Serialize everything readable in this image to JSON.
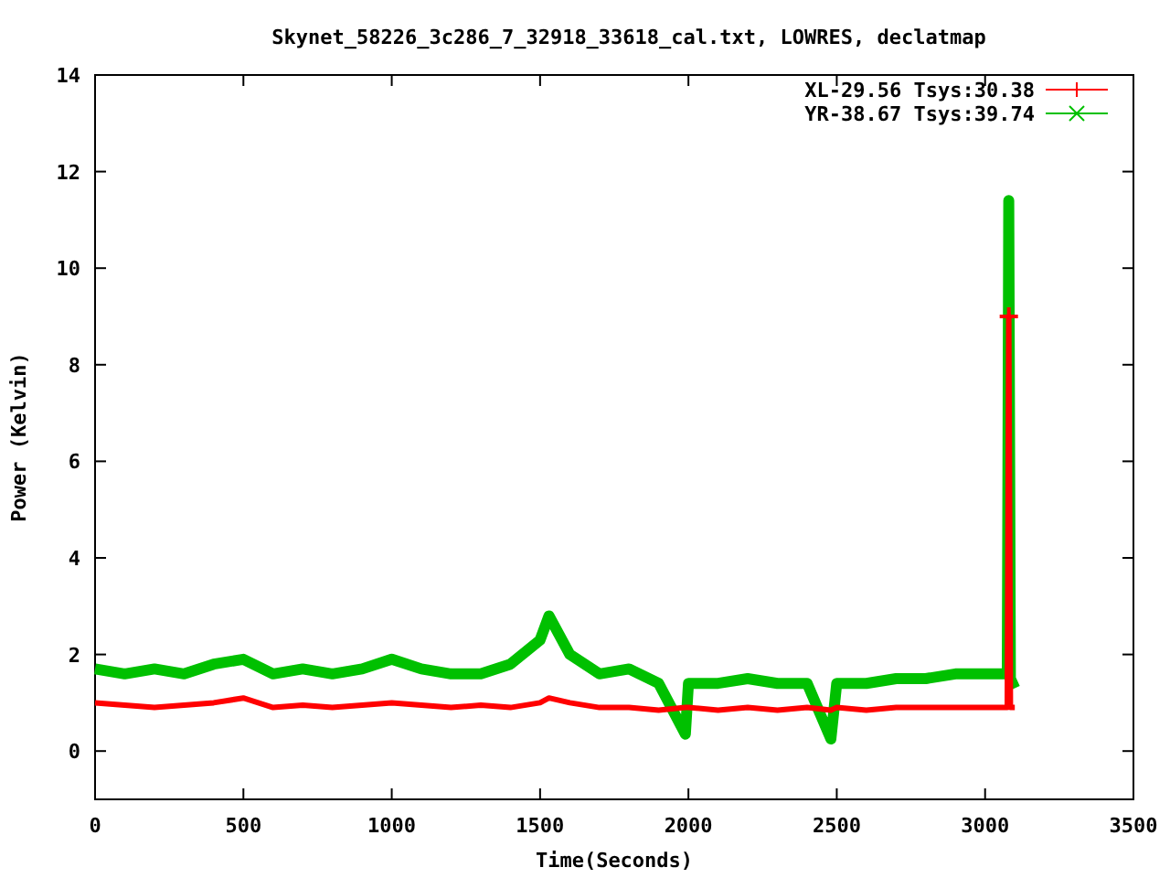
{
  "chart_data": {
    "type": "line",
    "title": "Skynet_58226_3c286_7_32918_33618_cal.txt, LOWRES, declatmap",
    "xlabel": "Time(Seconds)",
    "ylabel": "Power (Kelvin)",
    "x": [
      0,
      100,
      200,
      300,
      400,
      500,
      600,
      700,
      800,
      900,
      1000,
      1100,
      1200,
      1300,
      1400,
      1500,
      1530,
      1600,
      1700,
      1800,
      1900,
      1990,
      2000,
      2100,
      2200,
      2300,
      2400,
      2480,
      2500,
      2600,
      2700,
      2800,
      2900,
      3000,
      3075,
      3080,
      3085,
      3100
    ],
    "series": [
      {
        "name": "XL-29.56 Tsys:30.38",
        "color": "#ff0000",
        "values": [
          1.0,
          0.95,
          0.9,
          0.95,
          1.0,
          1.1,
          0.9,
          0.95,
          0.9,
          0.95,
          1.0,
          0.95,
          0.9,
          0.95,
          0.9,
          1.0,
          1.1,
          1.0,
          0.9,
          0.9,
          0.85,
          0.9,
          0.9,
          0.85,
          0.9,
          0.85,
          0.9,
          0.85,
          0.9,
          0.85,
          0.9,
          0.9,
          0.9,
          0.9,
          0.9,
          9.0,
          0.9,
          0.9
        ]
      },
      {
        "name": "YR-38.67 Tsys:39.74",
        "color": "#00c000",
        "values": [
          1.7,
          1.6,
          1.7,
          1.6,
          1.8,
          1.9,
          1.6,
          1.7,
          1.6,
          1.7,
          1.9,
          1.7,
          1.6,
          1.6,
          1.8,
          2.3,
          2.8,
          2.0,
          1.6,
          1.7,
          1.4,
          0.35,
          1.4,
          1.4,
          1.5,
          1.4,
          1.4,
          0.25,
          1.4,
          1.4,
          1.5,
          1.5,
          1.6,
          1.6,
          1.6,
          11.4,
          1.5,
          1.3
        ]
      }
    ],
    "legend": true,
    "xlim": [
      0,
      3500
    ],
    "ylim": [
      -1,
      14
    ],
    "xticks": [
      0,
      500,
      1000,
      1500,
      2000,
      2500,
      3000,
      3500
    ],
    "yticks": [
      0,
      2,
      4,
      6,
      8,
      10,
      12,
      14
    ]
  }
}
